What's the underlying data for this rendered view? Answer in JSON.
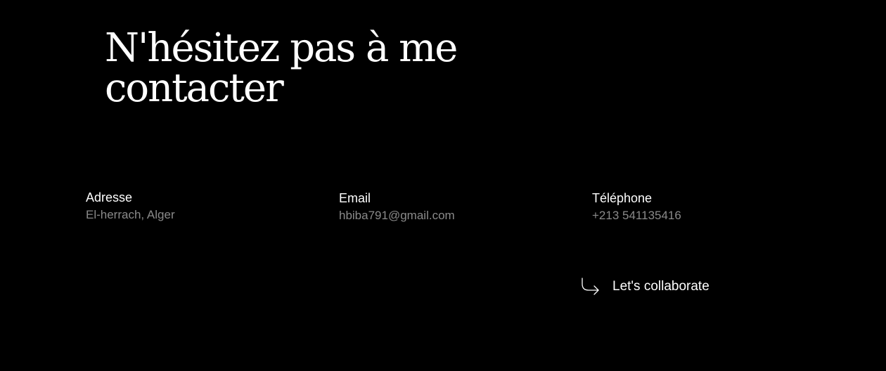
{
  "contact": {
    "heading_line1": "N'hésitez pas à me",
    "heading_line2": "contacter",
    "address": {
      "label": "Adresse",
      "value": "El-herrach, Alger"
    },
    "email": {
      "label": "Email",
      "value": "hbiba791@gmail.com"
    },
    "phone": {
      "label": "Téléphone",
      "value": "+213 541135416"
    },
    "cta": {
      "label": "Let's collaborate",
      "icon": "arrow-turn-down-right-icon"
    }
  },
  "colors": {
    "background": "#000000",
    "text": "#ffffff",
    "muted": "#8a8a8a"
  }
}
